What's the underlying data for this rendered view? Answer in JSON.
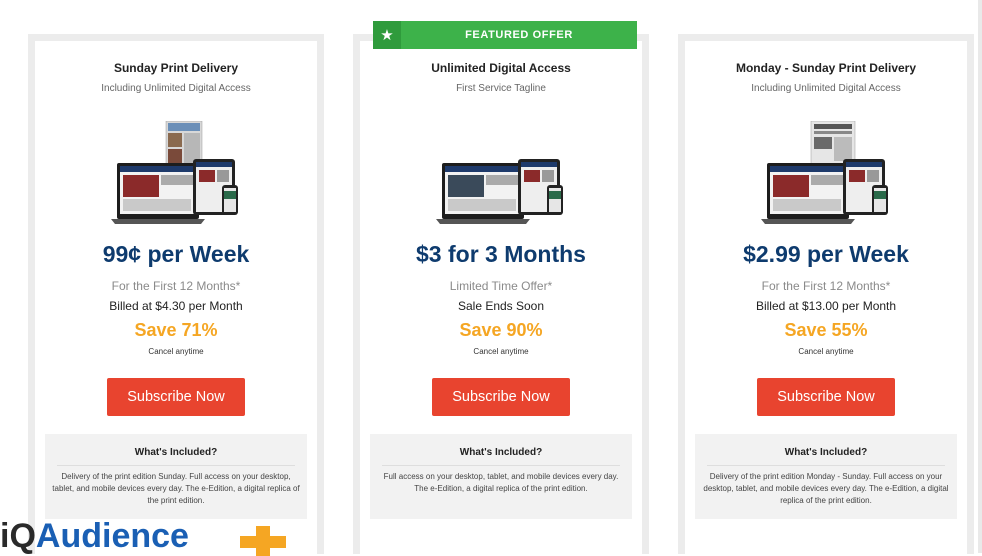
{
  "featured_label": "FEATURED OFFER",
  "plans": [
    {
      "title": "Sunday Print Delivery",
      "tagline": "Including Unlimited Digital Access",
      "price": "99¢ per Week",
      "sub1": "For the First 12 Months*",
      "sub2": "Billed at $4.30 per Month",
      "save": "Save 71%",
      "cancel": "Cancel anytime",
      "button": "Subscribe Now",
      "included_title": "What's Included?",
      "included_desc": "Delivery of the print edition Sunday. Full access on your desktop, tablet, and mobile devices every day. The e-Edition, a digital replica of the print edition."
    },
    {
      "title": "Unlimited Digital Access",
      "tagline": "First Service Tagline",
      "price": "$3 for 3 Months",
      "sub1": "Limited Time Offer*",
      "sub2": "Sale Ends Soon",
      "save": "Save 90%",
      "cancel": "Cancel anytime",
      "button": "Subscribe Now",
      "included_title": "What's Included?",
      "included_desc": "Full access on your desktop, tablet, and mobile devices every day. The e-Edition, a digital replica of the print edition."
    },
    {
      "title": "Monday - Sunday Print Delivery",
      "tagline": "Including Unlimited Digital Access",
      "price": "$2.99 per Week",
      "sub1": "For the First 12 Months*",
      "sub2": "Billed at $13.00 per Month",
      "save": "Save 55%",
      "cancel": "Cancel anytime",
      "button": "Subscribe Now",
      "included_title": "What's Included?",
      "included_desc": "Delivery of the print edition Monday - Sunday. Full access on your desktop, tablet, and mobile devices every day. The e-Edition, a digital replica of the print edition."
    }
  ],
  "logo": {
    "prefix": "iQ",
    "main": "Audience"
  },
  "colors": {
    "price": "#0e3b6e",
    "save": "#f5a623",
    "button": "#e8442f",
    "featured": "#3db24a"
  },
  "icons": {
    "featured": "star-icon",
    "product": "devices-bundle-image",
    "logo_mark": "plus-icon"
  }
}
